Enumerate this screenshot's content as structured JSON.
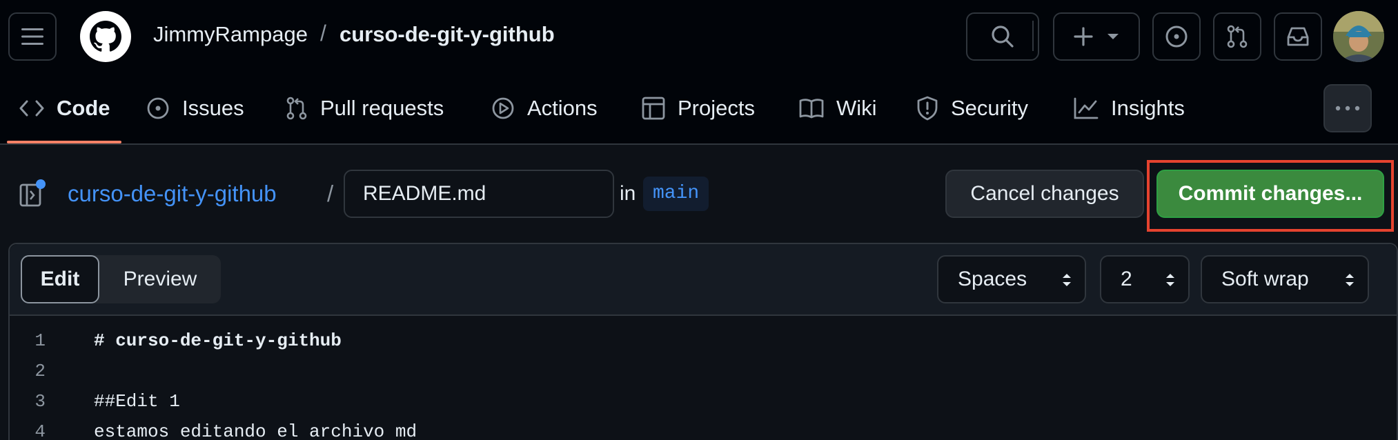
{
  "header": {
    "owner": "JimmyRampage",
    "separator": "/",
    "repo": "curso-de-git-y-github"
  },
  "repo_nav": {
    "tabs": [
      {
        "label": "Code",
        "icon": "code-icon",
        "active": true
      },
      {
        "label": "Issues",
        "icon": "issue-icon"
      },
      {
        "label": "Pull requests",
        "icon": "pull-request-icon"
      },
      {
        "label": "Actions",
        "icon": "play-icon"
      },
      {
        "label": "Projects",
        "icon": "table-icon"
      },
      {
        "label": "Wiki",
        "icon": "book-icon"
      },
      {
        "label": "Security",
        "icon": "shield-icon"
      },
      {
        "label": "Insights",
        "icon": "graph-icon"
      }
    ]
  },
  "file_bar": {
    "repo_link": "curso-de-git-y-github",
    "separator": "/",
    "filename": "README.md",
    "in_label": "in",
    "branch": "main",
    "cancel_label": "Cancel changes",
    "commit_label": "Commit changes..."
  },
  "editor": {
    "edit_tab": "Edit",
    "preview_tab": "Preview",
    "indent_mode": "Spaces",
    "indent_size": "2",
    "wrap_mode": "Soft wrap",
    "lines": [
      {
        "number": "1",
        "text": "# curso-de-git-y-github"
      },
      {
        "number": "2",
        "text": ""
      },
      {
        "number": "3",
        "text": "##Edit 1"
      },
      {
        "number": "4",
        "text": "estamos editando el archivo md"
      }
    ]
  },
  "colors": {
    "accent_link": "#4493f8",
    "commit_green": "#3b8a3e",
    "highlight_red": "#e5432f",
    "tab_underline": "#f78166"
  }
}
